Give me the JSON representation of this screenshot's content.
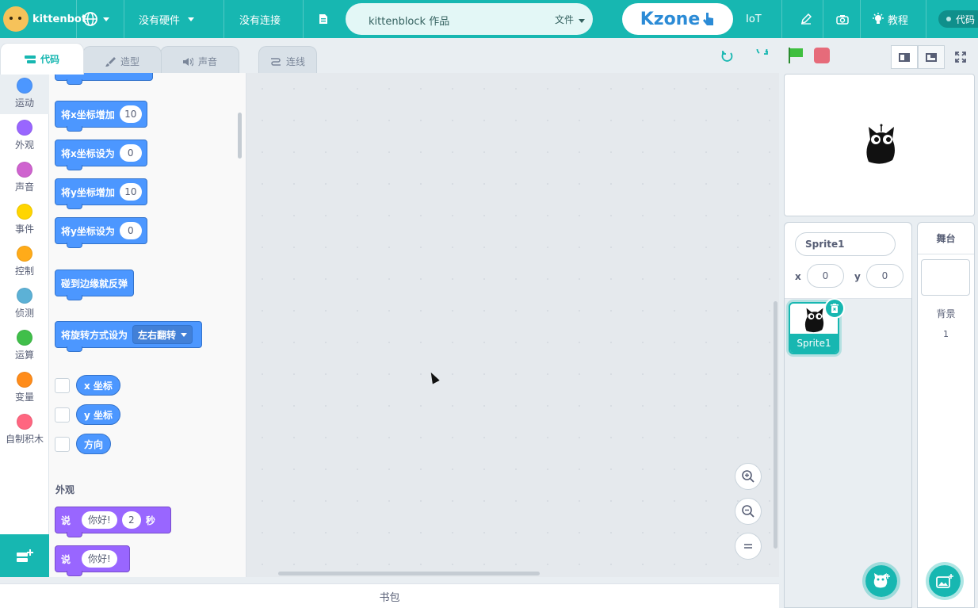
{
  "topbar": {
    "brand": "kittenbot",
    "hardware": "没有硬件",
    "connection": "没有连接",
    "project_title": "kittenblock 作品",
    "file_menu": "文件",
    "kzone": "Kzone",
    "iot": "IoT",
    "tutorial": "教程",
    "mode_toggle": "代码"
  },
  "tabs": [
    {
      "label": "代码",
      "icon": "code-icon"
    },
    {
      "label": "造型",
      "icon": "brush-icon"
    },
    {
      "label": "声音",
      "icon": "speaker-icon"
    },
    {
      "label": "连线",
      "icon": "wire-icon"
    }
  ],
  "categories": [
    {
      "label": "运动",
      "color": "#4c97ff"
    },
    {
      "label": "外观",
      "color": "#9966ff"
    },
    {
      "label": "声音",
      "color": "#cf63cf"
    },
    {
      "label": "事件",
      "color": "#ffd500"
    },
    {
      "label": "控制",
      "color": "#ffab19"
    },
    {
      "label": "侦测",
      "color": "#5cb1d6"
    },
    {
      "label": "运算",
      "color": "#40bf4a"
    },
    {
      "label": "变量",
      "color": "#ff8c1a"
    },
    {
      "label": "自制积木",
      "color": "#ff6680"
    }
  ],
  "blocks": {
    "change_x": {
      "label": "将x坐标增加",
      "value": "10"
    },
    "set_x": {
      "label": "将x坐标设为",
      "value": "0"
    },
    "change_y": {
      "label": "将y坐标增加",
      "value": "10"
    },
    "set_y": {
      "label": "将y坐标设为",
      "value": "0"
    },
    "bounce": {
      "label": "碰到边缘就反弹"
    },
    "rotation": {
      "label": "将旋转方式设为",
      "option": "左右翻转"
    },
    "x_pos": "x 坐标",
    "y_pos": "y 坐标",
    "direction": "方向",
    "looks_section": "外观",
    "say_secs": {
      "label": "说",
      "text": "你好!",
      "secs": "2",
      "unit": "秒"
    },
    "say": {
      "label": "说",
      "text": "你好!"
    }
  },
  "backpack": "书包",
  "sprite": {
    "name": "Sprite1",
    "x_label": "x",
    "x": "0",
    "y_label": "y",
    "y": "0",
    "thumb_label": "Sprite1"
  },
  "stage_pane": {
    "title": "舞台",
    "backdrop_label": "背景",
    "backdrop_count": "1"
  },
  "colors": {
    "accent": "#17b7b1",
    "motion": "#4c97ff",
    "looks": "#9966ff"
  }
}
